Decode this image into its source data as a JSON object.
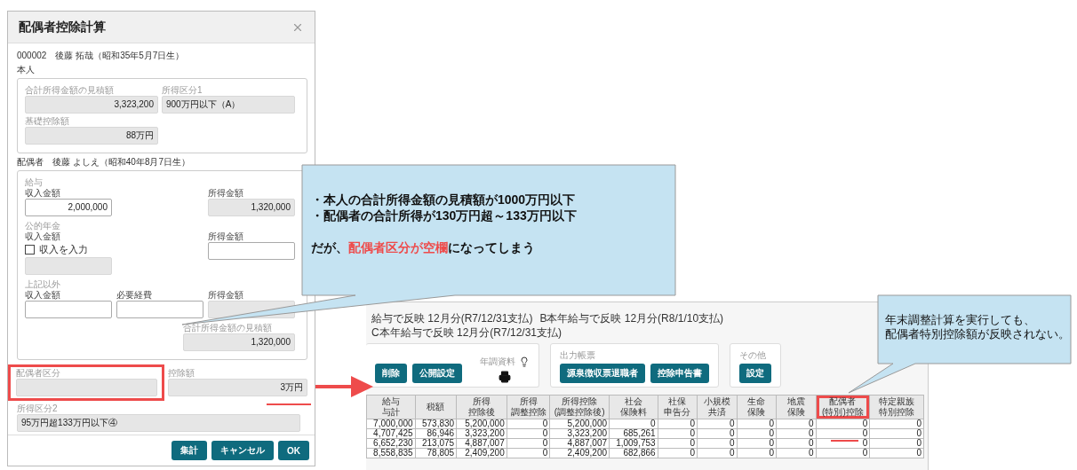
{
  "dialog": {
    "title": "配偶者控除計算",
    "employee": "000002　後藤 拓哉（昭和35年5月7日生）",
    "self": {
      "heading": "本人",
      "fields": [
        {
          "label": "合計所得金額の見積額",
          "value": "3,323,200",
          "readonly": true
        },
        {
          "label": "所得区分1",
          "value": "900万円以下（A）",
          "readonly": true
        },
        {
          "label": "基礎控除額",
          "value": "88万円",
          "readonly": true
        }
      ]
    },
    "spouse": {
      "heading": "配偶者　後藤 よしえ（昭和40年8月7日生）",
      "groups": [
        {
          "title": "給与",
          "fields": [
            {
              "label": "収入金額",
              "value": "2,000,000",
              "readonly": false
            },
            {
              "label": "所得金額",
              "value": "1,320,000",
              "readonly": true
            }
          ]
        },
        {
          "title": "公的年金",
          "fields": [
            {
              "label": "収入金額",
              "checkbox": {
                "label": "収入を入力",
                "checked": false
              },
              "readonly": true
            },
            {
              "label": "所得金額",
              "readonly": false
            }
          ]
        },
        {
          "title": "上記以外",
          "fields": [
            {
              "label": "収入金額",
              "readonly": false
            },
            {
              "label": "必要経費",
              "readonly": false
            },
            {
              "label": "所得金額",
              "readonly": true
            }
          ]
        }
      ],
      "total": {
        "label": "合計所得金額の見積額",
        "value": "1,320,000",
        "readonly": true
      }
    },
    "classification": {
      "label": "配偶者区分",
      "readonly": true
    },
    "deduction": {
      "label": "控除額",
      "value": "3万円",
      "readonly": true
    },
    "income_class2": {
      "label": "所得区分2",
      "value": "95万円超133万円以下④",
      "readonly": true
    },
    "buttons": [
      "集計",
      "キャンセル",
      "OK"
    ]
  },
  "payroll": {
    "payment_options": [
      "給与で反映 12月分(R7/12/31支払)",
      "B本年給与で反映 12月分(R8/1/10支払)",
      "C本年給与で反映 12月分(R7/12/31支払)"
    ],
    "cards": [
      {
        "buttons": [
          "削除",
          "公開設定"
        ],
        "print_label": "年調資料"
      },
      {
        "title": "出力帳票",
        "buttons": [
          "源泉徴収票退職者",
          "控除申告書"
        ]
      },
      {
        "title": "その他",
        "buttons": [
          "設定"
        ]
      }
    ],
    "table": {
      "columns": [
        {
          "lines": [
            "給与",
            "与計"
          ],
          "highlighted": false
        },
        {
          "lines": [
            "税額"
          ],
          "highlighted": false
        },
        {
          "lines": [
            "所得",
            "控除後"
          ],
          "highlighted": false
        },
        {
          "lines": [
            "所得",
            "調整控除"
          ],
          "highlighted": false
        },
        {
          "lines": [
            "所得控除",
            "(調整控除後)"
          ],
          "highlighted": false
        },
        {
          "lines": [
            "社会",
            "保険料"
          ],
          "highlighted": false
        },
        {
          "lines": [
            "社保",
            "申告分"
          ],
          "highlighted": false
        },
        {
          "lines": [
            "小規模",
            "共済"
          ],
          "highlighted": false
        },
        {
          "lines": [
            "生命",
            "保険"
          ],
          "highlighted": false
        },
        {
          "lines": [
            "地震",
            "保険"
          ],
          "highlighted": false
        },
        {
          "lines": [
            "配偶者",
            "(特別)控除"
          ],
          "highlighted": true
        },
        {
          "lines": [
            "特定親族",
            "特別控除"
          ],
          "highlighted": false
        }
      ],
      "rows": [
        [
          "7,000,000",
          "573,830",
          "5,200,000",
          "0",
          "5,200,000",
          "0",
          "0",
          "0",
          "0",
          "0",
          "0",
          "0"
        ],
        [
          "4,707,425",
          "86,946",
          "3,323,200",
          "0",
          "3,323,200",
          "685,261",
          "0",
          "0",
          "0",
          "0",
          "0",
          "0"
        ],
        [
          "6,652,230",
          "213,075",
          "4,887,007",
          "0",
          "4,887,007",
          "1,009,753",
          "0",
          "0",
          "0",
          "0",
          "0",
          "0"
        ],
        [
          "8,558,835",
          "78,805",
          "2,409,200",
          "0",
          "2,409,200",
          "682,866",
          "0",
          "0",
          "0",
          "0",
          "0",
          "0"
        ]
      ]
    }
  },
  "notes": [
    {
      "bullets": [
        "・本人の合計所得金額の見積額が1000万円以下",
        "・配偶者の合計所得が130万円超～133万円以下"
      ],
      "conclusion": [
        {
          "text": "だが、",
          "highlight": false
        },
        {
          "text": "配偶者区分が空欄",
          "highlight": true
        },
        {
          "text": "になってしまう",
          "highlight": false
        }
      ]
    },
    {
      "lines": [
        "年末調整計算を実行しても、",
        "配偶者特別控除額が反映されない。"
      ]
    }
  ]
}
